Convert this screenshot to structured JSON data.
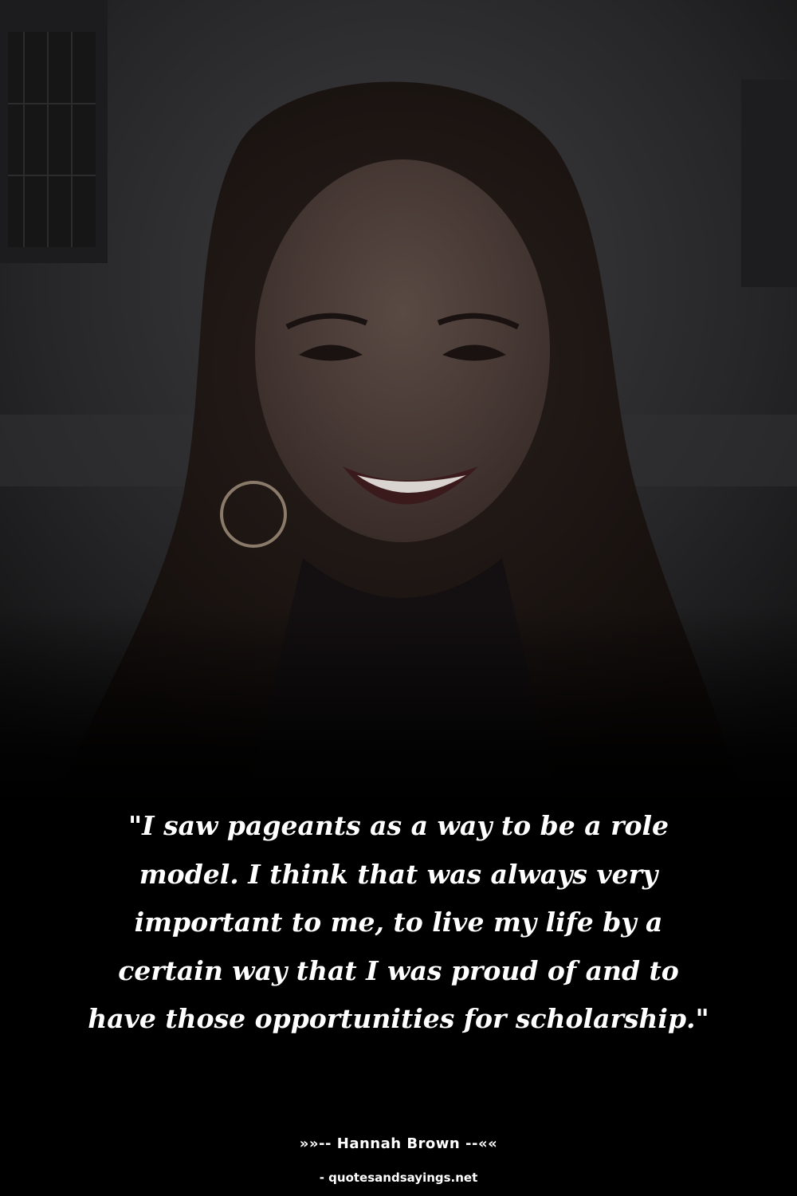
{
  "quote": {
    "text": "\"I saw pageants as a way to be a role model. I think that was always very important to me, to live my life by a certain way that I was proud of and to have those opportunities for scholarship.\"",
    "author_line": "»»-- Hannah Brown --««"
  },
  "source": {
    "label": "- quotesandsayings.net"
  },
  "colors": {
    "background": "#000000",
    "text": "#ffffff"
  }
}
